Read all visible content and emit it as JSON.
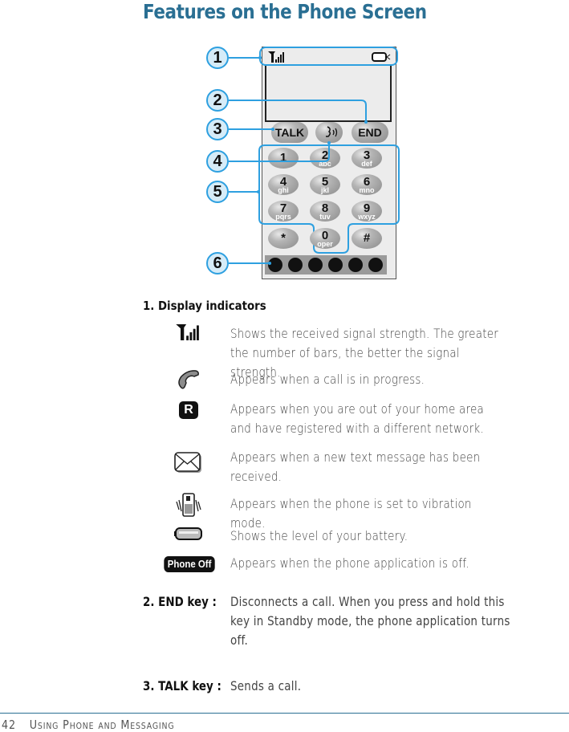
{
  "page": {
    "title": "Features on the Phone Screen",
    "footer": {
      "page_number": "42",
      "section": "Using Phone and Messaging"
    },
    "accent_color": "#2a6f93",
    "callout_color": "#2ea0e0"
  },
  "diagram": {
    "callouts": [
      "1",
      "2",
      "3",
      "4",
      "5",
      "6"
    ],
    "softkeys": {
      "talk": "TALK",
      "end": "END"
    },
    "keys": [
      {
        "num": "1",
        "sub": ""
      },
      {
        "num": "2",
        "sub": "abc"
      },
      {
        "num": "3",
        "sub": "def"
      },
      {
        "num": "4",
        "sub": "ghi"
      },
      {
        "num": "5",
        "sub": "jkl"
      },
      {
        "num": "6",
        "sub": "mno"
      },
      {
        "num": "7",
        "sub": "pqrs"
      },
      {
        "num": "8",
        "sub": "tuv"
      },
      {
        "num": "9",
        "sub": "wxyz"
      },
      {
        "num": "*",
        "sub": ""
      },
      {
        "num": "0",
        "sub": "oper"
      },
      {
        "num": "#",
        "sub": ""
      }
    ],
    "status_icons": [
      "signal-icon",
      "battery-icon"
    ],
    "bottom_bar_icons": [
      "home-icon",
      "contacts-icon",
      "call-log-icon",
      "phone-icon",
      "lock-icon",
      "satellite-icon"
    ]
  },
  "section1": {
    "heading": "1. Display indicators",
    "indicators": [
      {
        "icon": "signal-strength-icon",
        "text": "Shows the received signal strength. The greater the number of bars, the better the signal strength."
      },
      {
        "icon": "call-in-progress-icon",
        "text": "Appears when a call is in progress."
      },
      {
        "icon": "roaming-icon",
        "icon_label": "R",
        "text": "Appears when you are out of your home area and have registered with a different network."
      },
      {
        "icon": "message-icon",
        "text": "Appears when a new text message has been received."
      },
      {
        "icon": "vibration-icon",
        "text": "Appears when the phone is set to vibration mode."
      },
      {
        "icon": "battery-icon",
        "text": "Shows the level of your battery."
      },
      {
        "icon": "phone-off-icon",
        "icon_label": "Phone Off",
        "text": "Appears when the phone application is off."
      }
    ]
  },
  "section2": {
    "label": "2. END key :",
    "text": "Disconnects a call. When you press and hold this key in Standby mode, the phone application turns off."
  },
  "section3": {
    "label": "3. TALK key :",
    "text": "Sends a call."
  }
}
